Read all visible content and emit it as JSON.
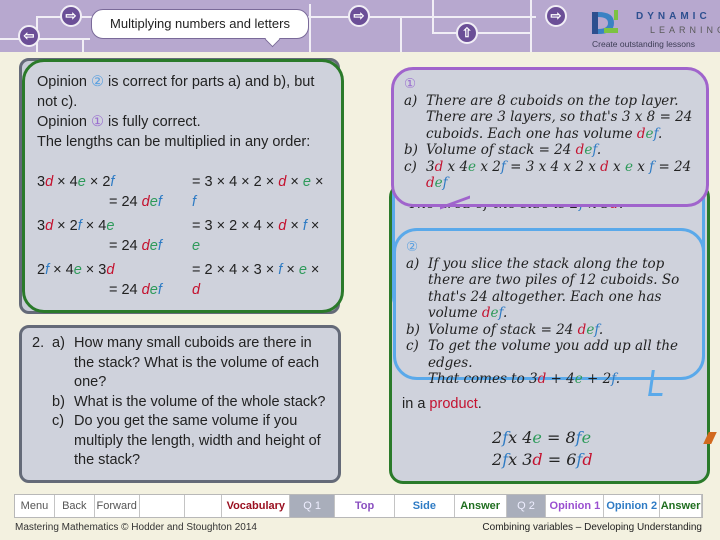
{
  "header": {
    "title": "Multiplying numbers and letters",
    "nav_icons": [
      {
        "name": "back-arrow-icon",
        "glyph": "⇦"
      },
      {
        "name": "forward-arrow-icon",
        "glyph": "⇨"
      },
      {
        "name": "forward-arrow-icon",
        "glyph": "⇨"
      },
      {
        "name": "up-arrow-icon",
        "glyph": "⇧"
      },
      {
        "name": "forward-arrow-icon",
        "glyph": "⇨"
      }
    ],
    "logo": {
      "line1": "DYNAMIC",
      "line2": "LEARNING",
      "tagline": "Create outstanding lessons"
    }
  },
  "answer_panel": {
    "line1_a": "Opinion ",
    "line1_circ": "②",
    "line1_b": " is correct for parts a) and b), but not c).",
    "line2_a": "Opinion ",
    "line2_circ": "①",
    "line2_b": " is fully correct.",
    "line3": "The lengths can be multiplied in any order:",
    "equations": [
      {
        "left": [
          [
            "",
            "3"
          ],
          [
            "d",
            "d"
          ],
          [
            "",
            " × 4"
          ],
          [
            "e",
            "e"
          ],
          [
            "",
            " × 2"
          ],
          [
            "f",
            "f"
          ]
        ],
        "right": [
          [
            "",
            "= 3 × 4 × 2 × "
          ],
          [
            "d",
            "d"
          ],
          [
            "",
            " × "
          ],
          [
            "e",
            "e"
          ],
          [
            "",
            " × "
          ],
          [
            "f",
            "f"
          ]
        ],
        "result": "= 24 "
      },
      {
        "left": [
          [
            "",
            "3"
          ],
          [
            "d",
            "d"
          ],
          [
            "",
            " × 2"
          ],
          [
            "f",
            "f"
          ],
          [
            "",
            " × 4"
          ],
          [
            "e",
            "e"
          ]
        ],
        "right": [
          [
            "",
            "= 3 × 2 × 4 × "
          ],
          [
            "d",
            "d"
          ],
          [
            "",
            " × "
          ],
          [
            "f",
            "f"
          ],
          [
            "",
            " × "
          ],
          [
            "e",
            "e"
          ]
        ],
        "result": "= 24 "
      },
      {
        "left": [
          [
            "",
            "2"
          ],
          [
            "f",
            "f"
          ],
          [
            "",
            " × 4"
          ],
          [
            "e",
            "e"
          ],
          [
            "",
            " × 3"
          ],
          [
            "d",
            "d"
          ]
        ],
        "right": [
          [
            "",
            "= 2 × 4 × 3 × "
          ],
          [
            "f",
            "f"
          ],
          [
            "",
            " × "
          ],
          [
            "e",
            "e"
          ],
          [
            "",
            " × "
          ],
          [
            "d",
            "d"
          ]
        ],
        "result": "= 24 "
      }
    ]
  },
  "question2": {
    "number": "2.",
    "parts": [
      {
        "label": "a)",
        "text": "How many small cuboids are there in the stack? What is the volume of each one?"
      },
      {
        "label": "b)",
        "text": "What is the volume of the whole stack?"
      },
      {
        "label": "c)",
        "text": "Do you get the same volume if you multiply the length, width and height of the stack?"
      }
    ]
  },
  "opinion1": {
    "marker": "①",
    "a_label": "a)",
    "a_text": "There are 8 cuboids on the top layer. There are 3 layers, so that's 3 x 8 = 24 cuboids. Each one has volume ",
    "b_label": "b)",
    "b_text": "Volume of stack = 24 ",
    "c_label": "c)",
    "c_text": [
      [
        "",
        "3"
      ],
      [
        "d",
        "d"
      ],
      [
        "",
        " x 4"
      ],
      [
        "e",
        "e"
      ],
      [
        "",
        " x 2"
      ],
      [
        "f",
        "f"
      ],
      [
        "",
        "      = 3 x 4 x 2 x "
      ],
      [
        "d",
        "d"
      ],
      [
        "",
        " x "
      ],
      [
        "e",
        "e"
      ],
      [
        "",
        " x "
      ],
      [
        "f",
        "f"
      ],
      [
        "",
        "      = 24 "
      ],
      [
        "d",
        "d"
      ],
      [
        "e",
        "e"
      ],
      [
        "f",
        "f"
      ]
    ]
  },
  "opinion2": {
    "marker": "②",
    "a_label": "a)",
    "a_text": "If you slice the stack along the top there are two piles of 12 cuboids. So that's 24 altogether. Each one has volume ",
    "b_label": "b)",
    "b_text": "Volume of stack = 24 ",
    "c_label": "c)",
    "c_text1": "To get the volume you add up all the edges.",
    "c_text2": [
      [
        "",
        "That comes to 3"
      ],
      [
        "d",
        "d"
      ],
      [
        "",
        " + 4"
      ],
      [
        "e",
        "e"
      ],
      [
        "",
        " + 2"
      ],
      [
        "f",
        "f"
      ],
      [
        "",
        "."
      ]
    ]
  },
  "background_answer": {
    "peek_text": [
      [
        "",
        "The area of the side is 2"
      ],
      [
        "f",
        "f"
      ],
      [
        "",
        " x 3"
      ],
      [
        "d",
        "d"
      ],
      [
        "",
        "."
      ]
    ],
    "in_a": "in a ",
    "product": "product",
    "period": ".",
    "eq1": [
      [
        "",
        "2"
      ],
      [
        "f",
        "f"
      ],
      [
        "",
        "x 4"
      ],
      [
        "e",
        "e"
      ],
      [
        "",
        " = 8"
      ],
      [
        "f",
        "f"
      ],
      [
        "e",
        "e"
      ]
    ],
    "eq2": [
      [
        "",
        "2"
      ],
      [
        "f",
        "f"
      ],
      [
        "",
        "x 3"
      ],
      [
        "d",
        "d"
      ],
      [
        "",
        " = 6"
      ],
      [
        "f",
        "f"
      ],
      [
        "d",
        "d"
      ]
    ]
  },
  "bottom_nav": [
    {
      "label": "Menu",
      "color": "#555555",
      "bold": false,
      "grey": false
    },
    {
      "label": "Back",
      "color": "#555555",
      "bold": false,
      "grey": false
    },
    {
      "label": "Forward",
      "color": "#555555",
      "bold": false,
      "grey": false
    },
    {
      "label": "",
      "color": "#555555",
      "bold": false,
      "grey": false
    },
    {
      "label": "",
      "color": "#555555",
      "bold": false,
      "grey": false
    },
    {
      "label": "Vocabulary",
      "color": "#9a1020",
      "bold": true,
      "grey": false
    },
    {
      "label": "Q 1",
      "color": "#eeeeff",
      "bold": false,
      "grey": true
    },
    {
      "label": "Top",
      "color": "#8a4fc0",
      "bold": true,
      "grey": false
    },
    {
      "label": "Side",
      "color": "#2e7bc4",
      "bold": true,
      "grey": false
    },
    {
      "label": "Answer",
      "color": "#1f6e1f",
      "bold": true,
      "grey": false
    },
    {
      "label": "Q 2",
      "color": "#eeeeff",
      "bold": false,
      "grey": true
    },
    {
      "label": "Opinion 1",
      "color": "#9a4fd0",
      "bold": true,
      "grey": false
    },
    {
      "label": "Opinion 2",
      "color": "#2e7bc4",
      "bold": true,
      "grey": false
    },
    {
      "label": "Answer",
      "color": "#1f6e1f",
      "bold": true,
      "grey": false
    }
  ],
  "footer": {
    "left": "Mastering Mathematics © Hodder and Stoughton 2014",
    "right": "Combining variables – Developing Understanding"
  },
  "colors": {
    "d": "#c4122f",
    "e": "#2e9a5a",
    "f": "#2e7bc4",
    "opinion1_border": "#a064cc",
    "opinion2_border": "#5aa9ea",
    "answer_border": "#2a7a2a",
    "header_bg": "#b7a8cf"
  }
}
